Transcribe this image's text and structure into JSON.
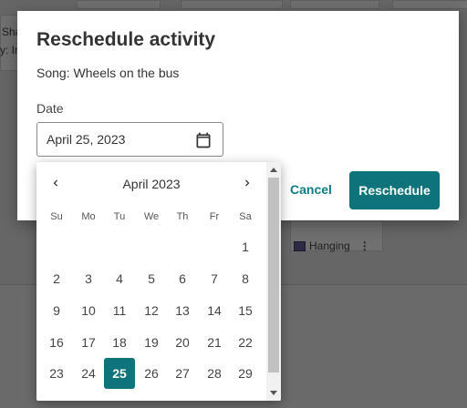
{
  "background": {
    "chip_label": "Hanging",
    "fragment_a": "Sha",
    "fragment_b": "y: In"
  },
  "dialog": {
    "title": "Reschedule activity",
    "song_line": "Song: Wheels on the bus",
    "date_label": "Date",
    "date_value": "April 25, 2023",
    "cancel_label": "Cancel",
    "reschedule_label": "Reschedule",
    "accent_color": "#0e737a"
  },
  "calendar": {
    "month_label": "April 2023",
    "weekdays": [
      "Su",
      "Mo",
      "Tu",
      "We",
      "Th",
      "Fr",
      "Sa"
    ],
    "weeks": [
      [
        "",
        "",
        "",
        "",
        "",
        "",
        "1"
      ],
      [
        "2",
        "3",
        "4",
        "5",
        "6",
        "7",
        "8"
      ],
      [
        "9",
        "10",
        "11",
        "12",
        "13",
        "14",
        "15"
      ],
      [
        "16",
        "17",
        "18",
        "19",
        "20",
        "21",
        "22"
      ],
      [
        "23",
        "24",
        "25",
        "26",
        "27",
        "28",
        "29"
      ]
    ],
    "selected_day": "25",
    "prev_icon": "chevron-left-icon",
    "next_icon": "chevron-right-icon"
  }
}
